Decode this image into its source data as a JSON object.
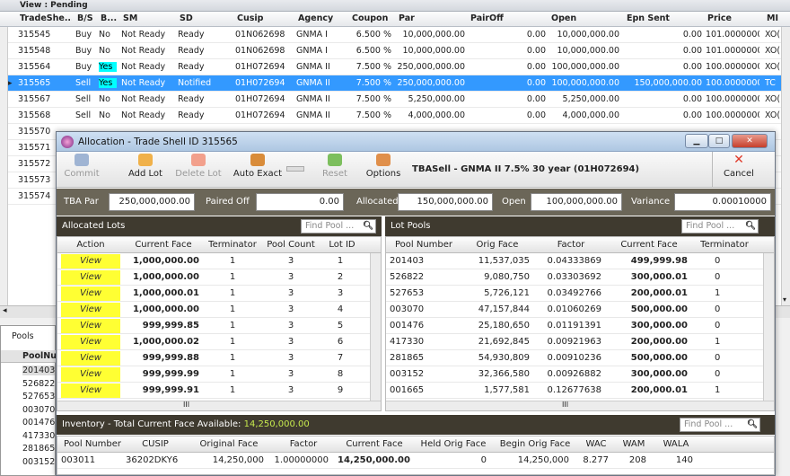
{
  "background_grid": {
    "view_label": "View : Pending",
    "columns": [
      "TradeShe...",
      "B/S",
      "B...",
      "SM",
      "SD",
      "Cusip",
      "Agency",
      "Coupon",
      "Par",
      "PairOff",
      "Open",
      "Epn Sent",
      "Price",
      "MI"
    ],
    "rows": [
      [
        "315545",
        "Buy",
        "No",
        "Not Ready",
        "Ready",
        "01N062698",
        "GNMA I",
        "6.500 %",
        "10,000,000.00",
        "0.00",
        "10,000,000.00",
        "0.00",
        "101.00000000",
        "XO("
      ],
      [
        "315548",
        "Buy",
        "No",
        "Not Ready",
        "Ready",
        "01N062698",
        "GNMA I",
        "6.500 %",
        "10,000,000.00",
        "0.00",
        "10,000,000.00",
        "0.00",
        "101.00000000",
        "XO("
      ],
      [
        "315564",
        "Buy",
        "Yes",
        "Not Ready",
        "Ready",
        "01H072694",
        "GNMA II",
        "7.500 %",
        "250,000,000.00",
        "0.00",
        "100,000,000.00",
        "0.00",
        "100.00000000",
        "XO("
      ],
      [
        "315565",
        "Sell",
        "Yes",
        "Not Ready",
        "Notified",
        "01H072694",
        "GNMA II",
        "7.500 %",
        "250,000,000.00",
        "0.00",
        "100,000,000.00",
        "150,000,000.00",
        "100.00000000",
        "TC"
      ],
      [
        "315567",
        "Sell",
        "No",
        "Not Ready",
        "Ready",
        "01H072694",
        "GNMA II",
        "7.500 %",
        "5,250,000.00",
        "0.00",
        "5,250,000.00",
        "0.00",
        "100.00000000",
        "XO("
      ],
      [
        "315568",
        "Sell",
        "No",
        "Not Ready",
        "Ready",
        "01H072694",
        "GNMA II",
        "7.500 %",
        "4,000,000.00",
        "0.00",
        "4,000,000.00",
        "0.00",
        "100.00000000",
        "XO("
      ],
      [
        "315570",
        "",
        "",
        "",
        "",
        "",
        "",
        "",
        "",
        "",
        "",
        "",
        "",
        ""
      ],
      [
        "315571",
        "",
        "",
        "",
        "",
        "",
        "",
        "",
        "",
        "",
        "",
        "",
        "",
        ""
      ],
      [
        "315572",
        "",
        "",
        "",
        "",
        "",
        "",
        "",
        "",
        "",
        "",
        "",
        "",
        ""
      ],
      [
        "315573",
        "",
        "",
        "",
        "",
        "",
        "",
        "",
        "",
        "",
        "",
        "",
        "",
        ""
      ],
      [
        "315574",
        "",
        "",
        "",
        "",
        "",
        "",
        "",
        "",
        "",
        "",
        "",
        "",
        ""
      ]
    ]
  },
  "left_pane": {
    "tab": "Pools",
    "header": "PoolNu",
    "rows": [
      "201403",
      "526822",
      "527653",
      "003070",
      "001476",
      "417330",
      "281865",
      "003152"
    ]
  },
  "dialog": {
    "title": "Allocation - Trade Shell ID 315565",
    "toolbar": {
      "commit": "Commit",
      "add_lot": "Add Lot",
      "delete_lot": "Delete Lot",
      "auto_exact": "Auto Exact",
      "reset": "Reset",
      "options": "Options",
      "cancel": "Cancel",
      "trade_desc": "TBASell - GNMA II  7.5%  30 year  (01H072694)"
    },
    "summary": {
      "tba_par_label": "TBA Par",
      "tba_par": "250,000,000.00",
      "paired_off_label": "Paired Off",
      "paired_off": "0.00",
      "allocated_label": "Allocated",
      "allocated": "150,000,000.00",
      "open_label": "Open",
      "open": "100,000,000.00",
      "variance_label": "Variance",
      "variance": "0.00010000"
    },
    "allocated_lots": {
      "header": "Allocated Lots",
      "find_placeholder": "Find Pool ...",
      "columns": [
        "Action",
        "Current Face",
        "Terminator",
        "Pool Count",
        "Lot ID"
      ],
      "rows": [
        [
          "View",
          "1,000,000.00",
          "1",
          "3",
          "1"
        ],
        [
          "View",
          "1,000,000.00",
          "1",
          "3",
          "2"
        ],
        [
          "View",
          "1,000,000.01",
          "1",
          "3",
          "3"
        ],
        [
          "View",
          "1,000,000.00",
          "1",
          "3",
          "4"
        ],
        [
          "View",
          "999,999.85",
          "1",
          "3",
          "5"
        ],
        [
          "View",
          "1,000,000.02",
          "1",
          "3",
          "6"
        ],
        [
          "View",
          "999,999.88",
          "1",
          "3",
          "7"
        ],
        [
          "View",
          "999,999.99",
          "1",
          "3",
          "8"
        ],
        [
          "View",
          "999,999.91",
          "1",
          "3",
          "9"
        ]
      ]
    },
    "lot_pools": {
      "header": "Lot Pools",
      "find_placeholder": "Find Pool ...",
      "columns": [
        "Pool Number",
        "Orig Face",
        "Factor",
        "Current Face",
        "Terminator"
      ],
      "rows": [
        [
          "201403",
          "11,537,035",
          "0.04333869",
          "499,999.98",
          "0"
        ],
        [
          "526822",
          "9,080,750",
          "0.03303692",
          "300,000.01",
          "0"
        ],
        [
          "527653",
          "5,726,121",
          "0.03492766",
          "200,000.01",
          "1"
        ],
        [
          "003070",
          "47,157,844",
          "0.01060269",
          "500,000.00",
          "0"
        ],
        [
          "001476",
          "25,180,650",
          "0.01191391",
          "300,000.00",
          "0"
        ],
        [
          "417330",
          "21,692,845",
          "0.00921963",
          "200,000.00",
          "1"
        ],
        [
          "281865",
          "54,930,809",
          "0.00910236",
          "500,000.00",
          "0"
        ],
        [
          "003152",
          "32,366,580",
          "0.00926882",
          "300,000.00",
          "0"
        ],
        [
          "001665",
          "1,577,581",
          "0.12677638",
          "200,000.01",
          "1"
        ]
      ]
    },
    "inventory": {
      "header_prefix": "Inventory - Total Current Face Available: ",
      "total": "14,250,000.00",
      "find_placeholder": "Find Pool ...",
      "columns": [
        "Pool Number",
        "CUSIP",
        "Original Face",
        "Factor",
        "Current Face",
        "Held Orig Face",
        "Begin Orig Face",
        "WAC",
        "WAM",
        "WALA"
      ],
      "row": [
        "003011",
        "36202DKY6",
        "14,250,000",
        "1.00000000",
        "14,250,000.00",
        "0",
        "14,250,000",
        "8.277",
        "208",
        "140"
      ]
    }
  }
}
